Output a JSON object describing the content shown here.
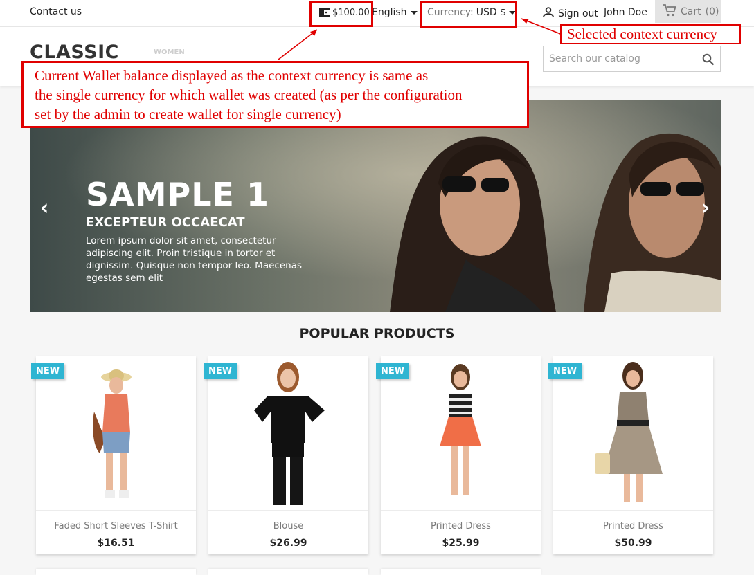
{
  "topnav": {
    "contact_label": "Contact us",
    "wallet_balance": "$100.00",
    "language": "English",
    "currency_label": "Currency:",
    "currency_value": "USD $",
    "signout_label": "Sign out",
    "user_name": "John Doe",
    "cart_label": "Cart",
    "cart_count": "(0)"
  },
  "header": {
    "logo_text": "CLASSIC",
    "menu_item": "WOMEN",
    "search_placeholder": "Search our catalog"
  },
  "carousel": {
    "title": "SAMPLE 1",
    "subtitle": "EXCEPTEUR OCCAECAT",
    "text": "Lorem ipsum dolor sit amet, consectetur adipiscing elit. Proin tristique in tortor et dignissim. Quisque non tempor leo. Maecenas egestas sem elit",
    "prev_glyph": "‹",
    "next_glyph": "›"
  },
  "popular": {
    "heading": "POPULAR PRODUCTS",
    "products": [
      {
        "flag": "NEW",
        "name": "Faded Short Sleeves T-Shirt",
        "price": "$16.51"
      },
      {
        "flag": "NEW",
        "name": "Blouse",
        "price": "$26.99"
      },
      {
        "flag": "NEW",
        "name": "Printed Dress",
        "price": "$25.99"
      },
      {
        "flag": "NEW",
        "name": "Printed Dress",
        "price": "$50.99"
      }
    ]
  },
  "annotations": {
    "selected_currency_note": "Selected context currency",
    "wallet_note_line1": "Current Wallet balance displayed as the context currency is same as",
    "wallet_note_line2": "the single currency for which wallet was created (as per the configuration",
    "wallet_note_line3": "set by the admin to create wallet for single currency)"
  },
  "colors": {
    "accent": "#2fb5d2",
    "annotation": "#e00000"
  },
  "icons": [
    "wallet-icon",
    "caret-down-icon",
    "person-icon",
    "cart-icon",
    "search-icon",
    "chevron-left-icon",
    "chevron-right-icon"
  ]
}
